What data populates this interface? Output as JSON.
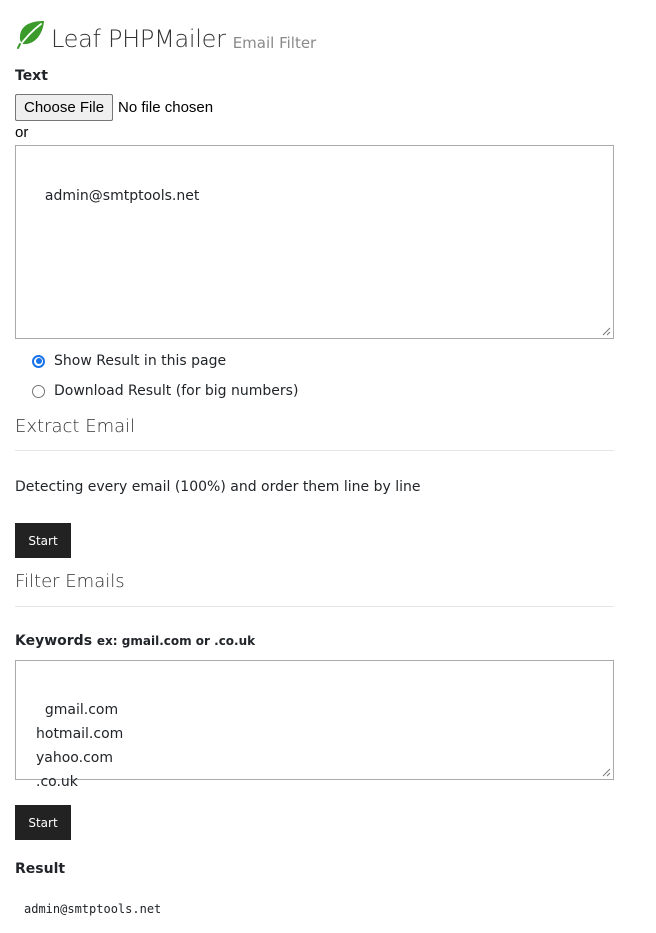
{
  "header": {
    "brand": "Leaf PHPMailer",
    "subtitle": "Email Filter",
    "logo_icon": "leaf-icon",
    "logo_color": "#3a9a2a"
  },
  "text_section": {
    "label": "Text",
    "file_button": "Choose File",
    "file_status": "No file chosen",
    "or": "or",
    "textarea_value": "admin@smtptools.net"
  },
  "output_options": [
    {
      "label": "Show Result in this page",
      "checked": true
    },
    {
      "label": "Download Result (for big numbers)",
      "checked": false
    }
  ],
  "extract": {
    "title": "Extract Email",
    "description": "Detecting every email (100%) and order them line by line",
    "button": "Start"
  },
  "filter": {
    "title": "Filter Emails",
    "keywords_label": "Keywords",
    "keywords_hint": "ex: gmail.com or .co.uk",
    "keywords_value": "gmail.com\nhotmail.com\nyahoo.com\n.co.uk",
    "button": "Start"
  },
  "result": {
    "label": "Result",
    "value": "admin@smtptools.net"
  },
  "colors": {
    "accent_radio": "#1a73e8",
    "button_bg": "#222222"
  }
}
